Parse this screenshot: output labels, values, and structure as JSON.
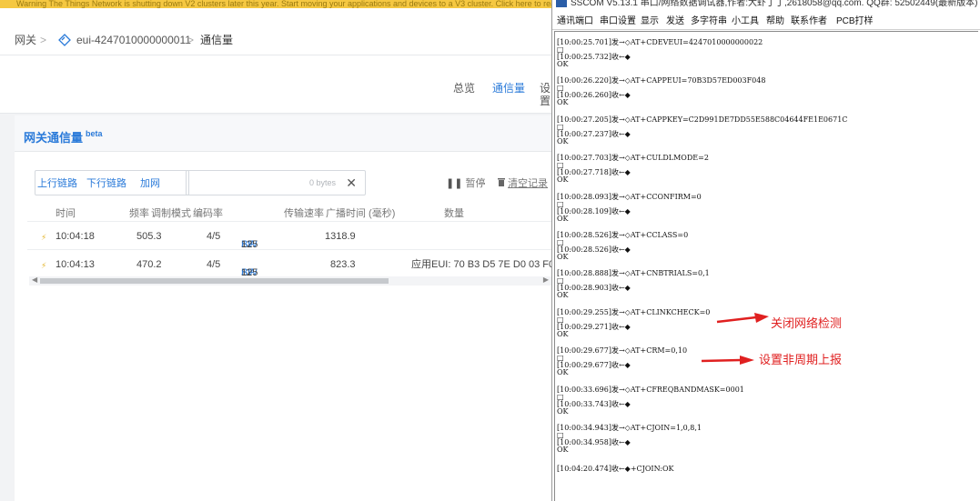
{
  "warning_text": "Warning  The Things Network is shutting down V2 clusters later this year. Start moving your applications and devices to a V3 cluster. Click here to read more",
  "breadcrumb": {
    "gateways": "网关",
    "sep": ">",
    "device": "eui-4247010000000011",
    "current": "通信量",
    "beta": "beta"
  },
  "page_tabs": {
    "overview": "总览",
    "traffic": "通信量",
    "settings": "设置"
  },
  "panel": {
    "title": "网关通信量",
    "beta": "beta",
    "uplink": "上行链路",
    "downlink": "下行链路",
    "join": "加网",
    "filter_value": "0 bytes",
    "clear_icon": "✕",
    "pause": "暂停",
    "clear_log": "清空记录"
  },
  "table": {
    "columns": [
      "时间",
      "频率",
      "调制模式",
      "编码率",
      "传输速率",
      "广播时间 (毫秒)",
      "数量"
    ],
    "rows": [
      {
        "time": "10:04:18",
        "freq": "505.3",
        "cr": "4/5",
        "sf_label": "SF",
        "sf": "12",
        "bw_label": "BW",
        "bw": "125",
        "airtime": "1318.9",
        "payload": ""
      },
      {
        "time": "10:04:13",
        "freq": "470.2",
        "cr": "4/5",
        "sf_label": "SF",
        "sf": "11",
        "bw_label": "BW",
        "bw": "125",
        "airtime": "823.3",
        "payload": "应用EUI:  70 B3 D5 7E D0 03 F0"
      }
    ]
  },
  "sscom": {
    "title": "SSCOM V5.13.1 串口/网络数据调试器,作者:大虾丁丁,2618058@qq.com. QQ群: 52502449(最新版本)",
    "menu": [
      "通讯端口",
      "串口设置",
      "显示",
      "发送",
      "多字符串",
      "小工具",
      "帮助",
      "联系作者",
      "PCB打样"
    ],
    "log": [
      {
        "send": "[10:00:25.701]发→◇AT+CDEVEUI=4247010000000022",
        "box": "□",
        "recv": "[10:00:25.732]收←◆",
        "ok": "OK"
      },
      {
        "send": "[10:00:26.220]发→◇AT+CAPPEUI=70B3D57ED003F048",
        "box": "□",
        "recv": "[10:00:26.260]收←◆",
        "ok": "OK"
      },
      {
        "send": "[10:00:27.205]发→◇AT+CAPPKEY=C2D991DE7DD55E588C04644FE1E0671C",
        "box": "□",
        "recv": "[10:00:27.237]收←◆",
        "ok": "OK"
      },
      {
        "send": "[10:00:27.703]发→◇AT+CULDLMODE=2",
        "box": "□",
        "recv": "[10:00:27.718]收←◆",
        "ok": "OK"
      },
      {
        "send": "[10:00:28.093]发→◇AT+CCONFIRM=0",
        "box": "□",
        "recv": "[10:00:28.109]收←◆",
        "ok": "OK"
      },
      {
        "send": "[10:00:28.526]发→◇AT+CCLASS=0",
        "box": "□",
        "recv": "[10:00:28.526]收←◆",
        "ok": "OK"
      },
      {
        "send": "[10:00:28.888]发→◇AT+CNBTRIALS=0,1",
        "box": "□",
        "recv": "[10:00:28.903]收←◆",
        "ok": "OK"
      },
      {
        "send": "[10:00:29.255]发→◇AT+CLINKCHECK=0",
        "box": "□",
        "recv": "[10:00:29.271]收←◆",
        "ok": "OK"
      },
      {
        "send": "[10:00:29.677]发→◇AT+CRM=0,10",
        "box": "□",
        "recv": "[10:00:29.677]收←◆",
        "ok": "OK"
      },
      {
        "send": "[10:00:33.696]发→◇AT+CFREQBANDMASK=0001",
        "box": "□",
        "recv": "[10:00:33.743]收←◆",
        "ok": "OK"
      },
      {
        "send": "[10:00:34.943]发→◇AT+CJOIN=1,0,8,1",
        "box": "□",
        "recv": "[10:00:34.958]收←◆",
        "ok": "OK"
      }
    ],
    "last_line": "[10:04:20.474]收←◆+CJOIN:OK"
  },
  "annotations": {
    "link_check": "关闭网络检测",
    "non_periodic": "设置非周期上报"
  },
  "colors": {
    "accent": "#2a7ad9",
    "warning": "#f5c842",
    "annotation": "#e02020"
  }
}
